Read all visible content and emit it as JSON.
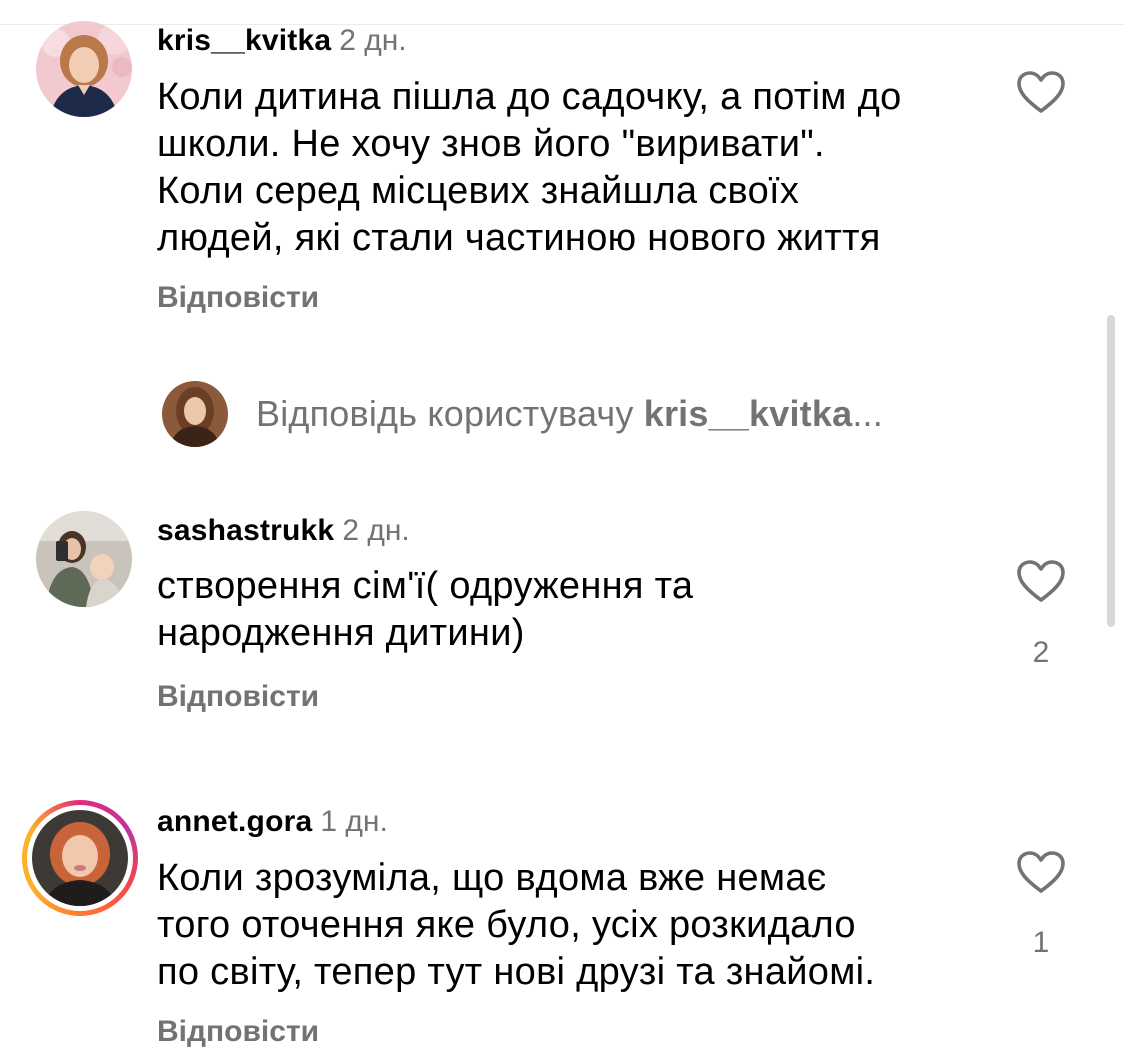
{
  "comments": [
    {
      "username": "kris__kvitka",
      "time": "2 дн.",
      "lines": [
        "Коли дитина пішла до садочку, а потім до",
        "школи. Не хочу знов його \"виривати\".",
        "Коли серед місцевих знайшла своїх",
        "людей, які стали частиною нового життя"
      ],
      "reply_label": "Відповісти",
      "likes": ""
    },
    {
      "username": "sashastrukk",
      "time": "2 дн.",
      "lines": [
        "створення сім'ї( одруження та",
        "народження дитини)"
      ],
      "reply_label": "Відповісти",
      "likes": "2"
    },
    {
      "username": "annet.gora",
      "time": "1 дн.",
      "lines": [
        "Коли зрозуміла, що вдома вже немає",
        "того оточення яке було, усіх розкидало",
        "по світу, тепер тут нові друзі та знайомі."
      ],
      "reply_label": "Відповісти",
      "likes": "1"
    }
  ],
  "composer": {
    "prefix": "Відповідь користувачу ",
    "target_username": "kris__kvitka",
    "ellipsis": "..."
  },
  "colors": {
    "secondary_text": "#737373",
    "primary_text": "#000000",
    "story_ring": [
      "#e3287e",
      "#f4474a",
      "#fcb12c"
    ]
  }
}
